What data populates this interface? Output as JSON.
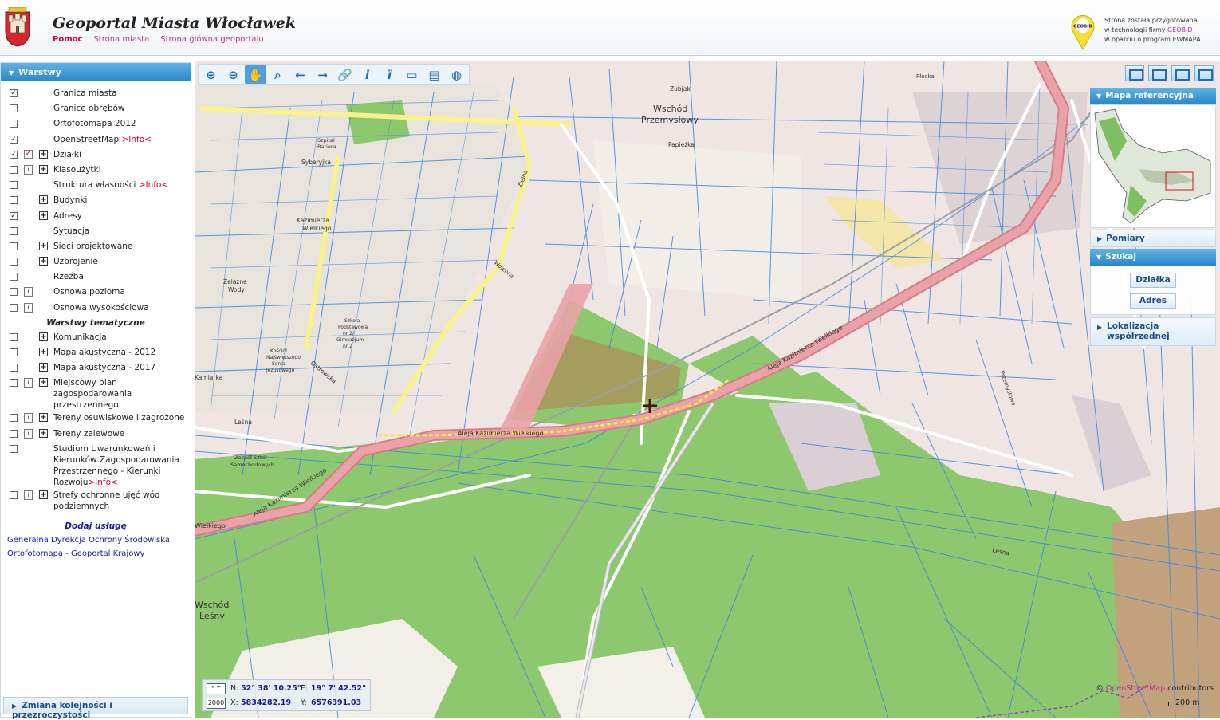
{
  "header": {
    "title": "Geoportal Miasta Włocławek",
    "links": [
      "Pomoc",
      "Strona miasta",
      "Strona główna geoportalu"
    ],
    "brand_line1": "Strona została przygotowana",
    "brand_line2_pre": "w technologii firmy ",
    "brand_line2_hl": "GEOBID",
    "brand_line3": "w oparciu o program EWMAPA",
    "brand_pin_label": "GEOBID"
  },
  "left_panel": {
    "header": "Warstwy",
    "layers": [
      {
        "label": "Granica miasta",
        "checked": true
      },
      {
        "label": "Granice obrębów",
        "checked": false
      },
      {
        "label": "Ortofotomapa 2012",
        "checked": false
      },
      {
        "label": "OpenStreetMap ",
        "info": ">Info<",
        "checked": true
      },
      {
        "label": "Działki",
        "checked": true
      },
      {
        "label": "Klasoużytki",
        "checked": false
      },
      {
        "label": "Struktura własności ",
        "info": ">Info<",
        "checked": false
      },
      {
        "label": "Budynki",
        "checked": false
      },
      {
        "label": "Adresy",
        "checked": true
      },
      {
        "label": "Sytuacja",
        "checked": false
      },
      {
        "label": "Sieci projektowane",
        "checked": false
      },
      {
        "label": "Uzbrojenie",
        "checked": false
      },
      {
        "label": "Rzeźba",
        "checked": false
      },
      {
        "label": "Osnowa pozioma",
        "checked": false
      },
      {
        "label": "Osnowa wysokościowa",
        "checked": false
      }
    ],
    "thematic_title": "Warstwy tematyczne",
    "thematic": [
      {
        "label": "Komunikacja",
        "checked": false
      },
      {
        "label": "Mapa akustyczna - 2012",
        "checked": false
      },
      {
        "label": "Mapa akustyczna - 2017",
        "checked": false
      },
      {
        "label": "Miejscowy plan zagospodarowania przestrzennego",
        "checked": false
      },
      {
        "label": "Tereny osuwiskowe i zagrożone",
        "checked": false
      },
      {
        "label": "Tereny zalewowe",
        "checked": false
      },
      {
        "label": "Studium Uwarunkowań i Kierunków Zagospodarowania Przestrzennego - Kierunki Rozwoju",
        "info": ">Info<",
        "checked": false
      },
      {
        "label": "Strefy ochronne ujęć wód podziemnych",
        "checked": false
      }
    ],
    "add_service_title": "Dodaj usługę",
    "services": [
      "Generalna Dyrekcja Ochrony Środowiska",
      "Ortofotomapa - Geoportal Krajowy"
    ],
    "bottom": "Zmiana kolejności i przezroczystości"
  },
  "right_panel": {
    "ref_map_header": "Mapa referencyjna",
    "measure": "Pomiary",
    "search_header": "Szukaj",
    "search_buttons": [
      "Działka",
      "Adres"
    ],
    "localize_line1": "Lokalizacja",
    "localize_line2": "współrzędnej"
  },
  "coords": {
    "n_label": "N:",
    "n_value": "52° 38' 10.25\"",
    "e_label": "E:",
    "e_value": "19° 7' 42.52\"",
    "x_label": "X:",
    "x_value": "5834282.19",
    "y_label": "Y:",
    "y_value": "6576391.03",
    "box1": "° '\"",
    "box2": "2000"
  },
  "attribution": {
    "prefix": "© ",
    "osm": "OpenStreetMap",
    "suffix": " contributors"
  },
  "scale_label": "200 m",
  "map_labels": {
    "wschod_przemyslowy_1": "Wschód",
    "wschod_przemyslowy_2": "Przemysłowy",
    "wschod_lesny_1": "Wschód",
    "wschod_lesny_2": "Leśny",
    "aleja_main": "Aleja Kazimierza Wielkiego",
    "aleja_ne": "Aleja Kazimierza Wielkiego",
    "aleja_sw": "Aleja Kazimierza Wielkiego",
    "aleja_w": "Wielkiego",
    "kazimierza_wielkiego_1": "Kazimierza",
    "kazimierza_wielkiego_2": "Wielkiego",
    "zelazne_wody_1": "Żelazne",
    "zelazne_wody_2": "Wody",
    "papiezka": "Papieżka",
    "zubiaki": "Zubjaki",
    "syberyjka": "Syberyjka",
    "kamiarka": "Kamiarka",
    "lesna": "Leśna",
    "lesna2": "Leśna",
    "zielna": "Zielna",
    "szpital_1": "Szpital",
    "szpital_2": "Bariera",
    "zespol_szkol": "Zespół Szkół",
    "zespol_szkol_2": "Samochodowych",
    "przemyslowa": "Przemysłowa",
    "ostrowska": "Ostrowska",
    "wojenna": "Wojenna",
    "plocka": "Płocka",
    "kosciol_1": "Kościół",
    "kosciol_2": "Najświętszego",
    "kosciol_3": "Serca",
    "kosciol_4": "Jezusowego",
    "szkola_1": "Szkoła",
    "szkola_2": "Podstawowa",
    "szkola_3": "nr 2/",
    "szkola_4": "Gimnazjum",
    "szkola_5": "nr 2"
  },
  "colors": {
    "accent_blue": "#2a86c8",
    "parcel_lines": "#3d86e0",
    "forest": "#8ec86e",
    "road_pink": "#e7999e",
    "yellow_road": "#f7f28a",
    "title_pink": "#c03090"
  }
}
